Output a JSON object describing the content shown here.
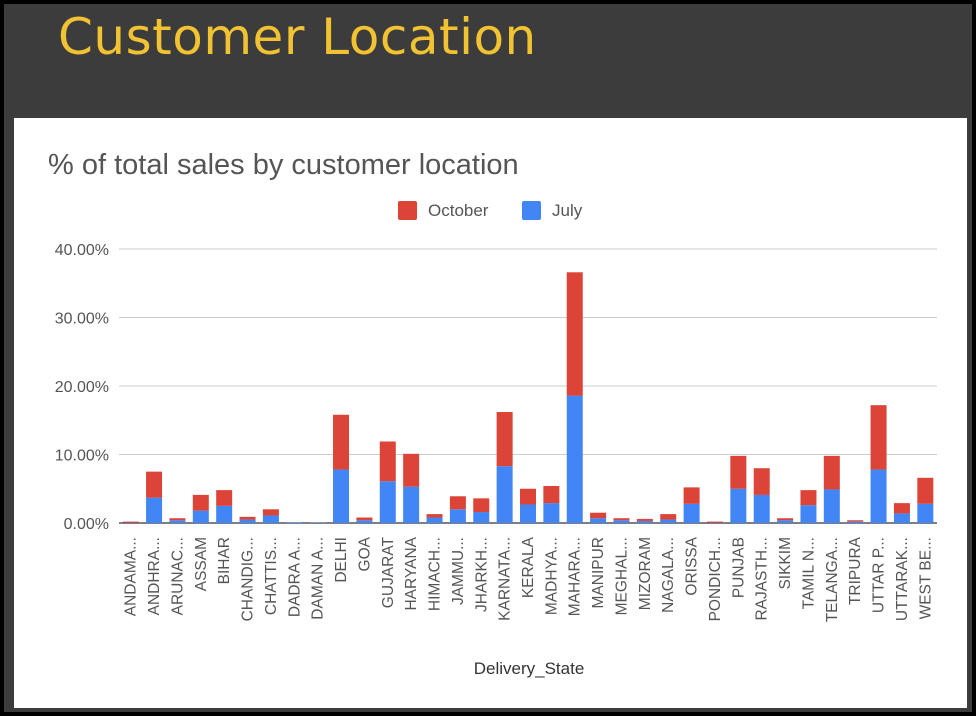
{
  "slide": {
    "title": "Customer Location"
  },
  "colors": {
    "october": "#db4437",
    "july": "#4285f4",
    "grid": "#cccccc",
    "baseline": "#333333"
  },
  "chart_data": {
    "type": "bar",
    "stacked": true,
    "title": "% of total sales by customer location",
    "xlabel": "Delivery_State",
    "ylabel": "",
    "ylim": [
      0,
      40
    ],
    "yticks": [
      "0.00%",
      "10.00%",
      "20.00%",
      "30.00%",
      "40.00%"
    ],
    "legend_position": "top",
    "categories": [
      "ANDAMA...",
      "ANDHRA...",
      "ARUNAC...",
      "ASSAM",
      "BIHAR",
      "CHANDIG...",
      "CHATTIS...",
      "DADRA A...",
      "DAMAN A...",
      "DELHI",
      "GOA",
      "GUJARAT",
      "HARYANA",
      "HIMACH...",
      "JAMMU...",
      "JHARKH...",
      "KARNATA...",
      "KERALA",
      "MADHYA...",
      "MAHARA...",
      "MANIPUR",
      "MEGHAL...",
      "MIZORAM",
      "NAGALA...",
      "ORISSA",
      "PONDICH...",
      "PUNJAB",
      "RAJASTH...",
      "SIKKIM",
      "TAMIL N...",
      "TELANGA...",
      "TRIPURA",
      "UTTAR P...",
      "UTTARAK...",
      "WEST BE..."
    ],
    "series": [
      {
        "name": "July",
        "color": "#4285f4",
        "values": [
          0.05,
          3.7,
          0.4,
          1.8,
          2.5,
          0.5,
          1.1,
          0.1,
          0.05,
          7.8,
          0.4,
          6.1,
          5.3,
          0.8,
          2.0,
          1.6,
          8.3,
          2.7,
          2.9,
          18.6,
          0.7,
          0.4,
          0.3,
          0.5,
          2.8,
          0.05,
          5.0,
          4.1,
          0.4,
          2.6,
          4.9,
          0.2,
          7.8,
          1.4,
          2.8
        ]
      },
      {
        "name": "October",
        "color": "#db4437",
        "values": [
          0.15,
          3.8,
          0.3,
          2.3,
          2.3,
          0.4,
          0.9,
          0.0,
          0.0,
          8.0,
          0.4,
          5.8,
          4.8,
          0.5,
          1.9,
          2.0,
          7.9,
          2.3,
          2.5,
          18.0,
          0.8,
          0.3,
          0.3,
          0.8,
          2.4,
          0.15,
          4.8,
          3.9,
          0.3,
          2.2,
          4.9,
          0.2,
          9.4,
          1.5,
          3.8
        ]
      }
    ]
  }
}
